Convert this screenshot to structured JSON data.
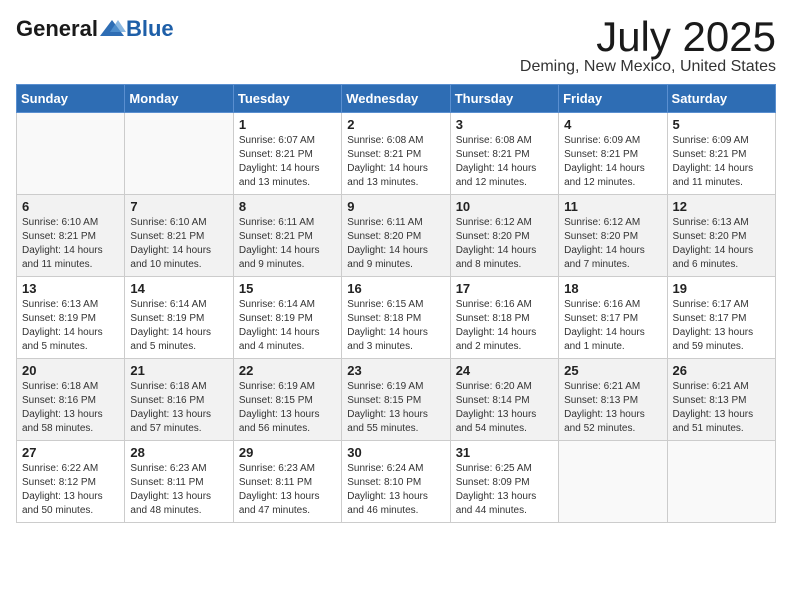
{
  "logo": {
    "general": "General",
    "blue": "Blue"
  },
  "title": "July 2025",
  "location": "Deming, New Mexico, United States",
  "days_of_week": [
    "Sunday",
    "Monday",
    "Tuesday",
    "Wednesday",
    "Thursday",
    "Friday",
    "Saturday"
  ],
  "weeks": [
    [
      {
        "day": "",
        "info": ""
      },
      {
        "day": "",
        "info": ""
      },
      {
        "day": "1",
        "info": "Sunrise: 6:07 AM\nSunset: 8:21 PM\nDaylight: 14 hours and 13 minutes."
      },
      {
        "day": "2",
        "info": "Sunrise: 6:08 AM\nSunset: 8:21 PM\nDaylight: 14 hours and 13 minutes."
      },
      {
        "day": "3",
        "info": "Sunrise: 6:08 AM\nSunset: 8:21 PM\nDaylight: 14 hours and 12 minutes."
      },
      {
        "day": "4",
        "info": "Sunrise: 6:09 AM\nSunset: 8:21 PM\nDaylight: 14 hours and 12 minutes."
      },
      {
        "day": "5",
        "info": "Sunrise: 6:09 AM\nSunset: 8:21 PM\nDaylight: 14 hours and 11 minutes."
      }
    ],
    [
      {
        "day": "6",
        "info": "Sunrise: 6:10 AM\nSunset: 8:21 PM\nDaylight: 14 hours and 11 minutes."
      },
      {
        "day": "7",
        "info": "Sunrise: 6:10 AM\nSunset: 8:21 PM\nDaylight: 14 hours and 10 minutes."
      },
      {
        "day": "8",
        "info": "Sunrise: 6:11 AM\nSunset: 8:21 PM\nDaylight: 14 hours and 9 minutes."
      },
      {
        "day": "9",
        "info": "Sunrise: 6:11 AM\nSunset: 8:20 PM\nDaylight: 14 hours and 9 minutes."
      },
      {
        "day": "10",
        "info": "Sunrise: 6:12 AM\nSunset: 8:20 PM\nDaylight: 14 hours and 8 minutes."
      },
      {
        "day": "11",
        "info": "Sunrise: 6:12 AM\nSunset: 8:20 PM\nDaylight: 14 hours and 7 minutes."
      },
      {
        "day": "12",
        "info": "Sunrise: 6:13 AM\nSunset: 8:20 PM\nDaylight: 14 hours and 6 minutes."
      }
    ],
    [
      {
        "day": "13",
        "info": "Sunrise: 6:13 AM\nSunset: 8:19 PM\nDaylight: 14 hours and 5 minutes."
      },
      {
        "day": "14",
        "info": "Sunrise: 6:14 AM\nSunset: 8:19 PM\nDaylight: 14 hours and 5 minutes."
      },
      {
        "day": "15",
        "info": "Sunrise: 6:14 AM\nSunset: 8:19 PM\nDaylight: 14 hours and 4 minutes."
      },
      {
        "day": "16",
        "info": "Sunrise: 6:15 AM\nSunset: 8:18 PM\nDaylight: 14 hours and 3 minutes."
      },
      {
        "day": "17",
        "info": "Sunrise: 6:16 AM\nSunset: 8:18 PM\nDaylight: 14 hours and 2 minutes."
      },
      {
        "day": "18",
        "info": "Sunrise: 6:16 AM\nSunset: 8:17 PM\nDaylight: 14 hours and 1 minute."
      },
      {
        "day": "19",
        "info": "Sunrise: 6:17 AM\nSunset: 8:17 PM\nDaylight: 13 hours and 59 minutes."
      }
    ],
    [
      {
        "day": "20",
        "info": "Sunrise: 6:18 AM\nSunset: 8:16 PM\nDaylight: 13 hours and 58 minutes."
      },
      {
        "day": "21",
        "info": "Sunrise: 6:18 AM\nSunset: 8:16 PM\nDaylight: 13 hours and 57 minutes."
      },
      {
        "day": "22",
        "info": "Sunrise: 6:19 AM\nSunset: 8:15 PM\nDaylight: 13 hours and 56 minutes."
      },
      {
        "day": "23",
        "info": "Sunrise: 6:19 AM\nSunset: 8:15 PM\nDaylight: 13 hours and 55 minutes."
      },
      {
        "day": "24",
        "info": "Sunrise: 6:20 AM\nSunset: 8:14 PM\nDaylight: 13 hours and 54 minutes."
      },
      {
        "day": "25",
        "info": "Sunrise: 6:21 AM\nSunset: 8:13 PM\nDaylight: 13 hours and 52 minutes."
      },
      {
        "day": "26",
        "info": "Sunrise: 6:21 AM\nSunset: 8:13 PM\nDaylight: 13 hours and 51 minutes."
      }
    ],
    [
      {
        "day": "27",
        "info": "Sunrise: 6:22 AM\nSunset: 8:12 PM\nDaylight: 13 hours and 50 minutes."
      },
      {
        "day": "28",
        "info": "Sunrise: 6:23 AM\nSunset: 8:11 PM\nDaylight: 13 hours and 48 minutes."
      },
      {
        "day": "29",
        "info": "Sunrise: 6:23 AM\nSunset: 8:11 PM\nDaylight: 13 hours and 47 minutes."
      },
      {
        "day": "30",
        "info": "Sunrise: 6:24 AM\nSunset: 8:10 PM\nDaylight: 13 hours and 46 minutes."
      },
      {
        "day": "31",
        "info": "Sunrise: 6:25 AM\nSunset: 8:09 PM\nDaylight: 13 hours and 44 minutes."
      },
      {
        "day": "",
        "info": ""
      },
      {
        "day": "",
        "info": ""
      }
    ]
  ],
  "row_shades": [
    false,
    true,
    false,
    true,
    false
  ]
}
